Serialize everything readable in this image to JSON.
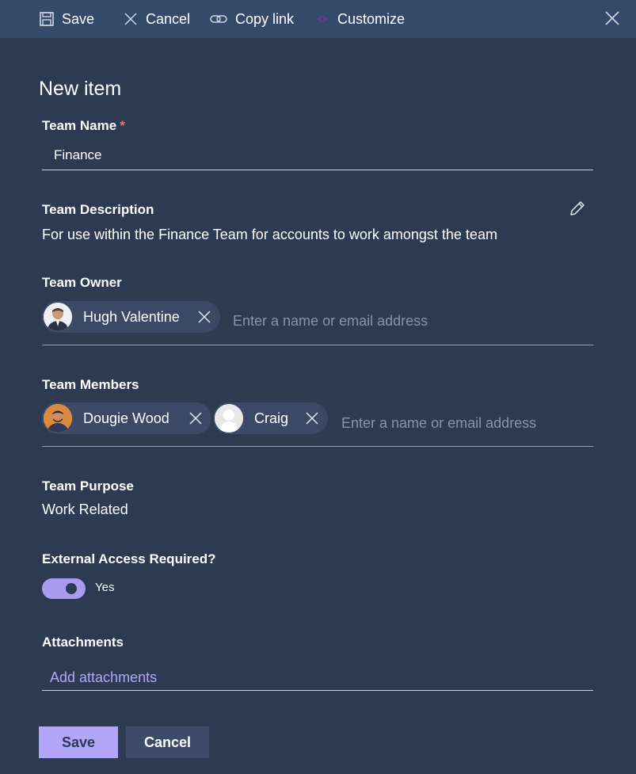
{
  "toolbar": {
    "save_label": "Save",
    "cancel_label": "Cancel",
    "copy_link_label": "Copy link",
    "customize_label": "Customize"
  },
  "form": {
    "title": "New item",
    "team_name": {
      "label": "Team Name",
      "required_mark": "*",
      "value": "Finance"
    },
    "team_description": {
      "label": "Team Description",
      "value": "For use within the Finance Team for accounts to work amongst the team"
    },
    "team_owner": {
      "label": "Team Owner",
      "people": [
        {
          "name": "Hugh Valentine"
        }
      ],
      "placeholder": "Enter a name or email address"
    },
    "team_members": {
      "label": "Team Members",
      "people": [
        {
          "name": "Dougie Wood"
        },
        {
          "name": "Craig"
        }
      ],
      "placeholder": "Enter a name or email address"
    },
    "team_purpose": {
      "label": "Team Purpose",
      "value": "Work Related"
    },
    "external_access": {
      "label": "External Access Required?",
      "value": "Yes",
      "on": true
    },
    "attachments": {
      "label": "Attachments",
      "add_label": "Add attachments"
    }
  },
  "footer": {
    "save_label": "Save",
    "cancel_label": "Cancel"
  },
  "colors": {
    "accent": "#b3a6f8",
    "background": "#2d3a52",
    "toolbar": "#35496a"
  }
}
